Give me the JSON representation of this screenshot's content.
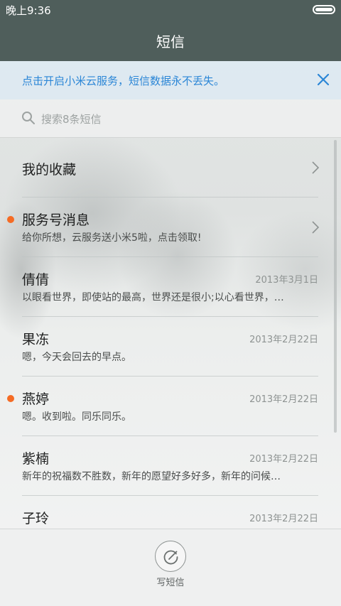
{
  "status": {
    "time": "晚上9:36"
  },
  "header": {
    "title": "短信"
  },
  "banner": {
    "text": "点击开启小米云服务，短信数据永不丢失。"
  },
  "search": {
    "placeholder": "搜索8条短信"
  },
  "colors": {
    "accent": "#2b86d6",
    "unread_dot": "#f56b24",
    "header_bg": "#4f5e5b"
  },
  "conversations": [
    {
      "name": "我的收藏",
      "preview": "",
      "date": "",
      "unread": false,
      "chevron": true
    },
    {
      "name": "服务号消息",
      "preview": "给你所想，云服务送小米5啦，点击领取!",
      "date": "",
      "unread": true,
      "chevron": true
    },
    {
      "name": "倩倩",
      "preview": "以眼看世界，即使站的最高，世界还是很小;以心看世界，…",
      "date": "2013年3月1日",
      "unread": false,
      "chevron": false
    },
    {
      "name": "果冻",
      "preview": "嗯，今天会回去的早点。",
      "date": "2013年2月22日",
      "unread": false,
      "chevron": false
    },
    {
      "name": "燕婷",
      "preview": "嗯。收到啦。同乐同乐。",
      "date": "2013年2月22日",
      "unread": true,
      "chevron": false
    },
    {
      "name": "紫楠",
      "preview": "新年的祝福数不胜数，新年的愿望好多好多，新年的问候…",
      "date": "2013年2月22日",
      "unread": false,
      "chevron": false
    },
    {
      "name": "子玲",
      "preview": "",
      "date": "2013年2月22日",
      "unread": false,
      "chevron": false
    }
  ],
  "bottom": {
    "compose_label": "写短信",
    "compose_icon": "compose-icon"
  }
}
